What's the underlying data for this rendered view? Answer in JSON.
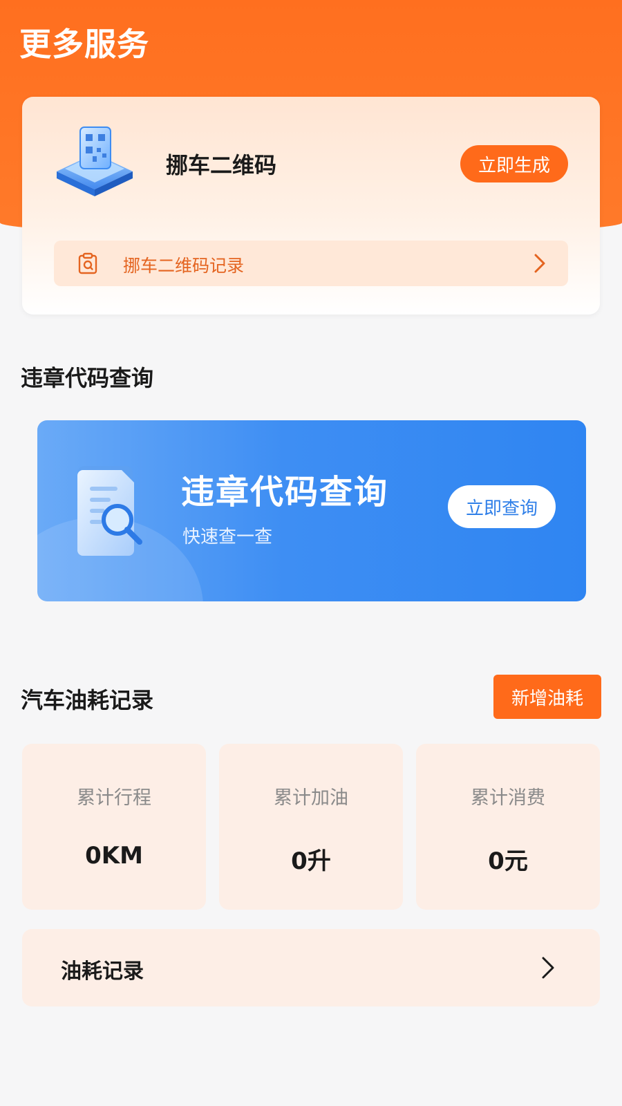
{
  "header": {
    "title": "更多服务"
  },
  "qr_card": {
    "title": "挪车二维码",
    "generate_button": "立即生成",
    "record_link": "挪车二维码记录",
    "illustration_icon": "qr-cube-icon",
    "record_icon": "clipboard-icon",
    "accent_color": "#ff6a1a"
  },
  "violation": {
    "section_title": "违章代码查询",
    "banner_title": "违章代码查询",
    "banner_subtitle": "快速查一查",
    "query_button": "立即查询",
    "illustration_icon": "document-search-icon",
    "banner_color": "#2f85f2"
  },
  "fuel": {
    "section_title": "汽车油耗记录",
    "add_button": "新增油耗",
    "stats": [
      {
        "label": "累计行程",
        "value": "0KM"
      },
      {
        "label": "累计加油",
        "value": "0升"
      },
      {
        "label": "累计消费",
        "value": "0元"
      }
    ],
    "record_row": "油耗记录"
  }
}
